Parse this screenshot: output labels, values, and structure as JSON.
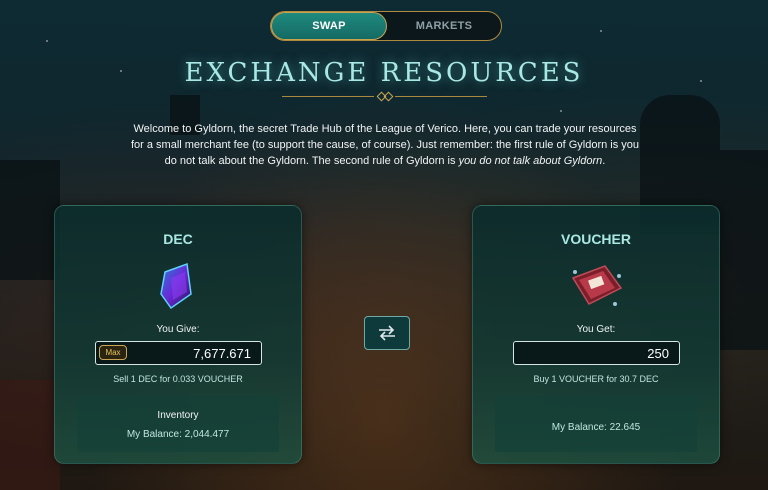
{
  "tabs": [
    {
      "label": "SWAP",
      "active": true
    },
    {
      "label": "MARKETS",
      "active": false
    }
  ],
  "title": "EXCHANGE RESOURCES",
  "intro": {
    "main": "Welcome to Gyldorn, the secret Trade Hub of the League of Verico. Here, you can trade your resources for a small merchant fee (to support the cause, of course). Just remember: the first rule of Gyldorn is you do not talk about the Gyldorn. The second rule of Gyldorn is ",
    "emphasis": "you do not talk about Gyldorn",
    "end": "."
  },
  "give": {
    "asset": "DEC",
    "label": "You Give:",
    "max_label": "Max",
    "value": "7,677.671",
    "rate": "Sell 1 DEC for 0.033 VOUCHER",
    "inventory_label": "Inventory",
    "balance": "My Balance: 2,044.477",
    "icon": "dec-crystal-icon"
  },
  "get": {
    "asset": "VOUCHER",
    "label": "You Get:",
    "value": "250",
    "rate": "Buy 1 VOUCHER for 30.7 DEC",
    "balance": "My Balance: 22.645",
    "icon": "voucher-ticket-icon"
  },
  "colors": {
    "accent_teal": "#1f8a7f",
    "title_teal": "#a9e8e3",
    "gold": "#c9a552"
  },
  "swap_icon": "swap-arrows-icon"
}
